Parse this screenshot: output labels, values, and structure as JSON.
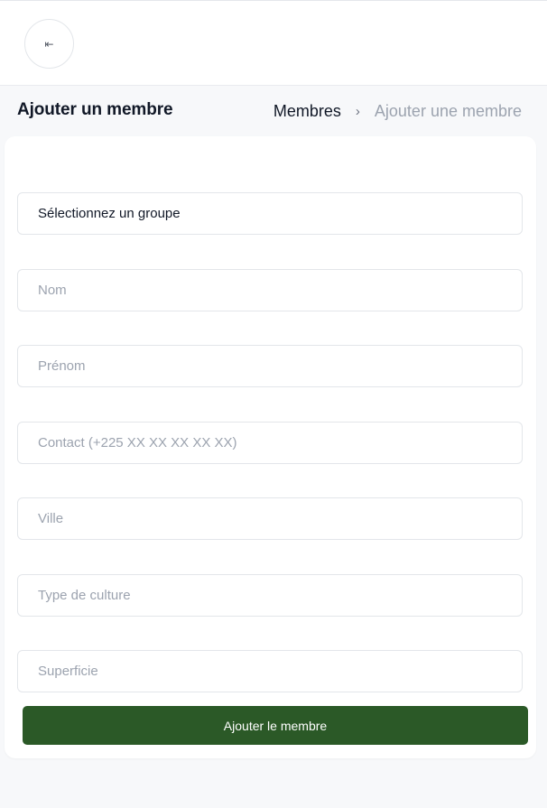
{
  "header": {
    "back_icon_glyph": "⇤",
    "back_icon": "collapse-left-icon"
  },
  "page": {
    "title": "Ajouter un membre"
  },
  "breadcrumb": {
    "parent": "Membres",
    "separator": "›",
    "current": "Ajouter une membre"
  },
  "form": {
    "group_select": {
      "value": "Sélectionnez un groupe"
    },
    "fields": {
      "nom": {
        "placeholder": "Nom"
      },
      "prenom": {
        "placeholder": "Prénom"
      },
      "contact": {
        "placeholder": "Contact (+225 XX XX XX XX XX)"
      },
      "ville": {
        "placeholder": "Ville"
      },
      "culture": {
        "placeholder": "Type de culture"
      },
      "superficie": {
        "placeholder": "Superficie"
      }
    },
    "submit_label": "Ajouter le membre"
  },
  "colors": {
    "primary": "#2b5927",
    "background": "#f7f8fa",
    "placeholder": "#9ca3af"
  }
}
